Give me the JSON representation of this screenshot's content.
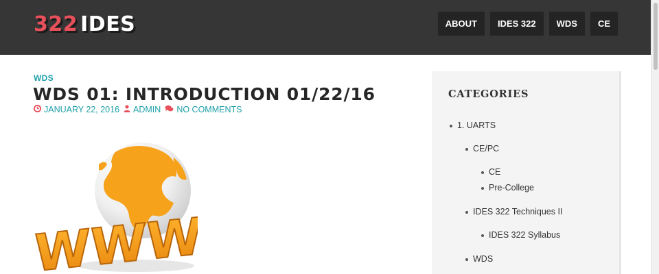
{
  "header": {
    "logo_number": "322",
    "logo_word": "IDES",
    "nav": [
      "ABOUT",
      "IDES 322",
      "WDS",
      "CE"
    ]
  },
  "post": {
    "category": "WDS",
    "title": "WDS 01: INTRODUCTION 01/22/16",
    "date": "JANUARY 22, 2016",
    "author": "ADMIN",
    "comments": "NO COMMENTS",
    "icons": [
      "clock-icon",
      "user-icon",
      "comments-icon"
    ],
    "image_text": "WWW"
  },
  "sidebar": {
    "title": "CATEGORIES",
    "items": [
      "1. UARTS",
      "CE/PC",
      "CE",
      "Pre-College",
      "IDES 322 Techniques II",
      "IDES 322 Syllabus",
      "WDS"
    ]
  },
  "colors": {
    "header_bg": "#363636",
    "nav_bg": "#242424",
    "accent_red": "#e8505b",
    "accent_teal": "#1fa0a8",
    "globe_orange": "#f7a21b"
  }
}
